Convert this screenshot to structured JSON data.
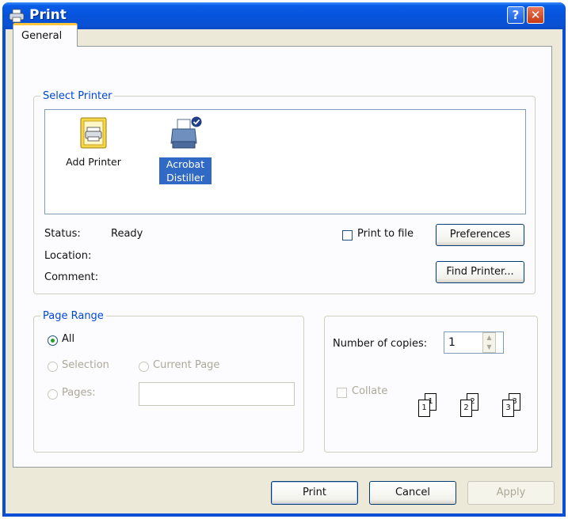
{
  "window": {
    "title": "Print",
    "help_label": "?",
    "close_label": "✕",
    "icon": "printer-icon"
  },
  "tabs": [
    {
      "label": "General",
      "active": true
    }
  ],
  "select_printer": {
    "legend": "Select Printer",
    "printers": [
      {
        "label_line1": "Add Printer",
        "label_line2": "",
        "icon": "add-printer-icon",
        "selected": false
      },
      {
        "label_line1": "Acrobat",
        "label_line2": "Distiller",
        "icon": "printer-icon",
        "selected": true
      }
    ],
    "status_label": "Status:",
    "status_value": "Ready",
    "location_label": "Location:",
    "comment_label": "Comment:",
    "print_to_file_label": "Print to file",
    "print_to_file_checked": false,
    "preferences_label": "Preferences",
    "find_printer_label": "Find Printer..."
  },
  "page_range": {
    "legend": "Page Range",
    "all_label": "All",
    "selection_label": "Selection",
    "current_page_label": "Current Page",
    "pages_label": "Pages:",
    "pages_value": "",
    "selected_option": "All"
  },
  "copies": {
    "number_label": "Number of copies:",
    "number_value": "1",
    "collate_label": "Collate",
    "collate_checked": false,
    "collate_pages": [
      "1",
      "1",
      "2",
      "2",
      "3",
      "3"
    ]
  },
  "buttons": {
    "print_label": "Print",
    "cancel_label": "Cancel",
    "apply_label": "Apply"
  },
  "colors": {
    "titlebar": "#0653db",
    "selection": "#316ac5",
    "group_legend": "#0046d5",
    "dialog_bg": "#ece9d8"
  }
}
